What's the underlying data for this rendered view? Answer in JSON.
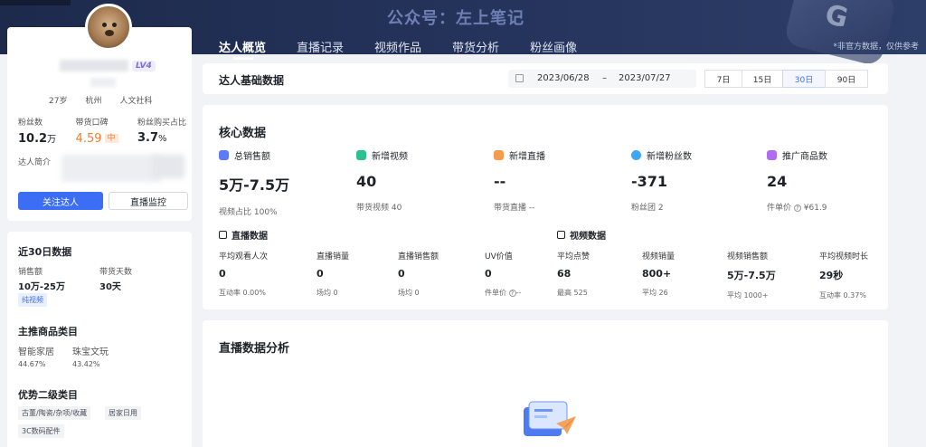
{
  "header": {
    "watermark": "公众号：左上笔记",
    "disclaimer": "*非官方数据，仅供参考",
    "tabs": [
      {
        "label": "达人概览",
        "active": true
      },
      {
        "label": "直播记录",
        "active": false
      },
      {
        "label": "视频作品",
        "active": false
      },
      {
        "label": "带货分析",
        "active": false
      },
      {
        "label": "粉丝画像",
        "active": false
      }
    ]
  },
  "profile": {
    "level": "LV4",
    "tags": [
      "27岁",
      "杭州",
      "人文社科"
    ],
    "stats": {
      "fans_label": "粉丝数",
      "fans_value": "10.2",
      "fans_unit": "万",
      "reputation_label": "带货口碑",
      "reputation_value": "4.59",
      "reputation_badge": "中",
      "buy_ratio_label": "粉丝购买占比",
      "buy_ratio_value": "3.7",
      "buy_ratio_unit": "%"
    },
    "intro_label": "达人简介",
    "follow_button": "关注达人",
    "monitor_button": "直播监控"
  },
  "recent": {
    "title": "近30日数据",
    "sales_label": "销售额",
    "sales_value": "10万-25万",
    "days_label": "带货天数",
    "days_value": "30天",
    "tag": "纯视频"
  },
  "main_category": {
    "title": "主推商品类目",
    "items": [
      {
        "name": "智能家居",
        "pct": "44.67%"
      },
      {
        "name": "珠宝文玩",
        "pct": "43.42%"
      }
    ]
  },
  "sub_category": {
    "title": "优势二级类目",
    "chips": [
      "古董/陶瓷/杂项/收藏",
      "居家日用",
      "3C数码配件"
    ]
  },
  "basic": {
    "title": "达人基础数据",
    "date_start": "2023/06/28",
    "date_sep": "–",
    "date_end": "2023/07/27",
    "periods": [
      {
        "label": "7日",
        "active": false
      },
      {
        "label": "15日",
        "active": false
      },
      {
        "label": "30日",
        "active": true
      },
      {
        "label": "90日",
        "active": false
      }
    ]
  },
  "core": {
    "title": "核心数据",
    "metrics": [
      {
        "label": "总销售额",
        "value": "5万-7.5万",
        "sub": "视频占比 100%",
        "icon": "sales-icon",
        "color": "#5b7cf6"
      },
      {
        "label": "新增视频",
        "value": "40",
        "sub": "带货视频 40",
        "icon": "video-icon",
        "color": "#2cc08f"
      },
      {
        "label": "新增直播",
        "value": "--",
        "sub": "带货直播 --",
        "icon": "live-icon",
        "color": "#f59b4c"
      },
      {
        "label": "新增粉丝数",
        "value": "-371",
        "sub": "粉丝团 2",
        "icon": "fans-icon",
        "color": "#3fa6f2"
      },
      {
        "label": "推广商品数",
        "value": "24",
        "sub": "件单价",
        "sub_value": "¥61.9",
        "icon": "goods-icon",
        "color": "#b06cf0"
      }
    ],
    "live_title": "直播数据",
    "live": [
      {
        "label": "平均观看人次",
        "value": "0",
        "sub": "互动率 0.00%"
      },
      {
        "label": "直播销量",
        "value": "0",
        "sub": "场均 0"
      },
      {
        "label": "直播销售额",
        "value": "0",
        "sub": "场均 0"
      },
      {
        "label": "UV价值",
        "value": "0",
        "sub": "件单价",
        "sub_value": "--"
      }
    ],
    "video_title": "视频数据",
    "video": [
      {
        "label": "平均点赞",
        "value": "68",
        "sub": "最高 525"
      },
      {
        "label": "视频销量",
        "value": "800+",
        "sub": "平均 26"
      },
      {
        "label": "视频销售额",
        "value": "5万-7.5万",
        "sub": "平均 1000+"
      },
      {
        "label": "平均视频时长",
        "value": "29秒",
        "sub": "互动率 0.37%"
      }
    ]
  },
  "analysis": {
    "title": "直播数据分析"
  }
}
